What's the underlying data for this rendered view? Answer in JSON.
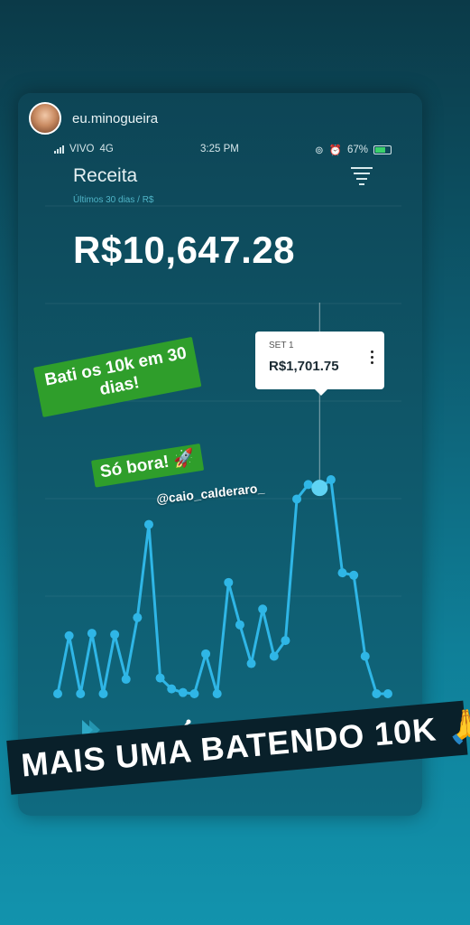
{
  "story": {
    "username": "eu.minogueira"
  },
  "statusbar": {
    "carrier": "VIVO",
    "network": "4G",
    "time": "3:25 PM",
    "battery": "67%"
  },
  "header": {
    "title": "Receita",
    "subtitle": "Últimos 30 dias / R$",
    "filter_icon": "filter-icon"
  },
  "summary": {
    "total": "R$10,647.28"
  },
  "tooltip": {
    "date": "SET 1",
    "value": "R$1,701.75"
  },
  "chart_data": {
    "type": "line",
    "y_unit": "R$",
    "grid": true,
    "color": "#2fb6e6",
    "values": [
      0,
      480,
      0,
      500,
      0,
      490,
      120,
      630,
      1400,
      130,
      40,
      10,
      0,
      330,
      0,
      920,
      570,
      250,
      700,
      310,
      440,
      1610,
      1730,
      1701.75,
      1770,
      1000,
      980,
      310,
      0,
      0
    ],
    "highlight_index": 23,
    "ylim": [
      0,
      3100
    ]
  },
  "nav": [
    "dashboard-icon",
    "charts-icon",
    "settings-icon",
    "more-icon"
  ],
  "stickers": {
    "line1": "Bati os 10k em 30",
    "line2": "dias!",
    "second": "Só bora! 🚀",
    "mention": "@caio_calderaro_"
  },
  "banner": {
    "text": "MAIS UMA BATENDO 10K 🙏"
  }
}
